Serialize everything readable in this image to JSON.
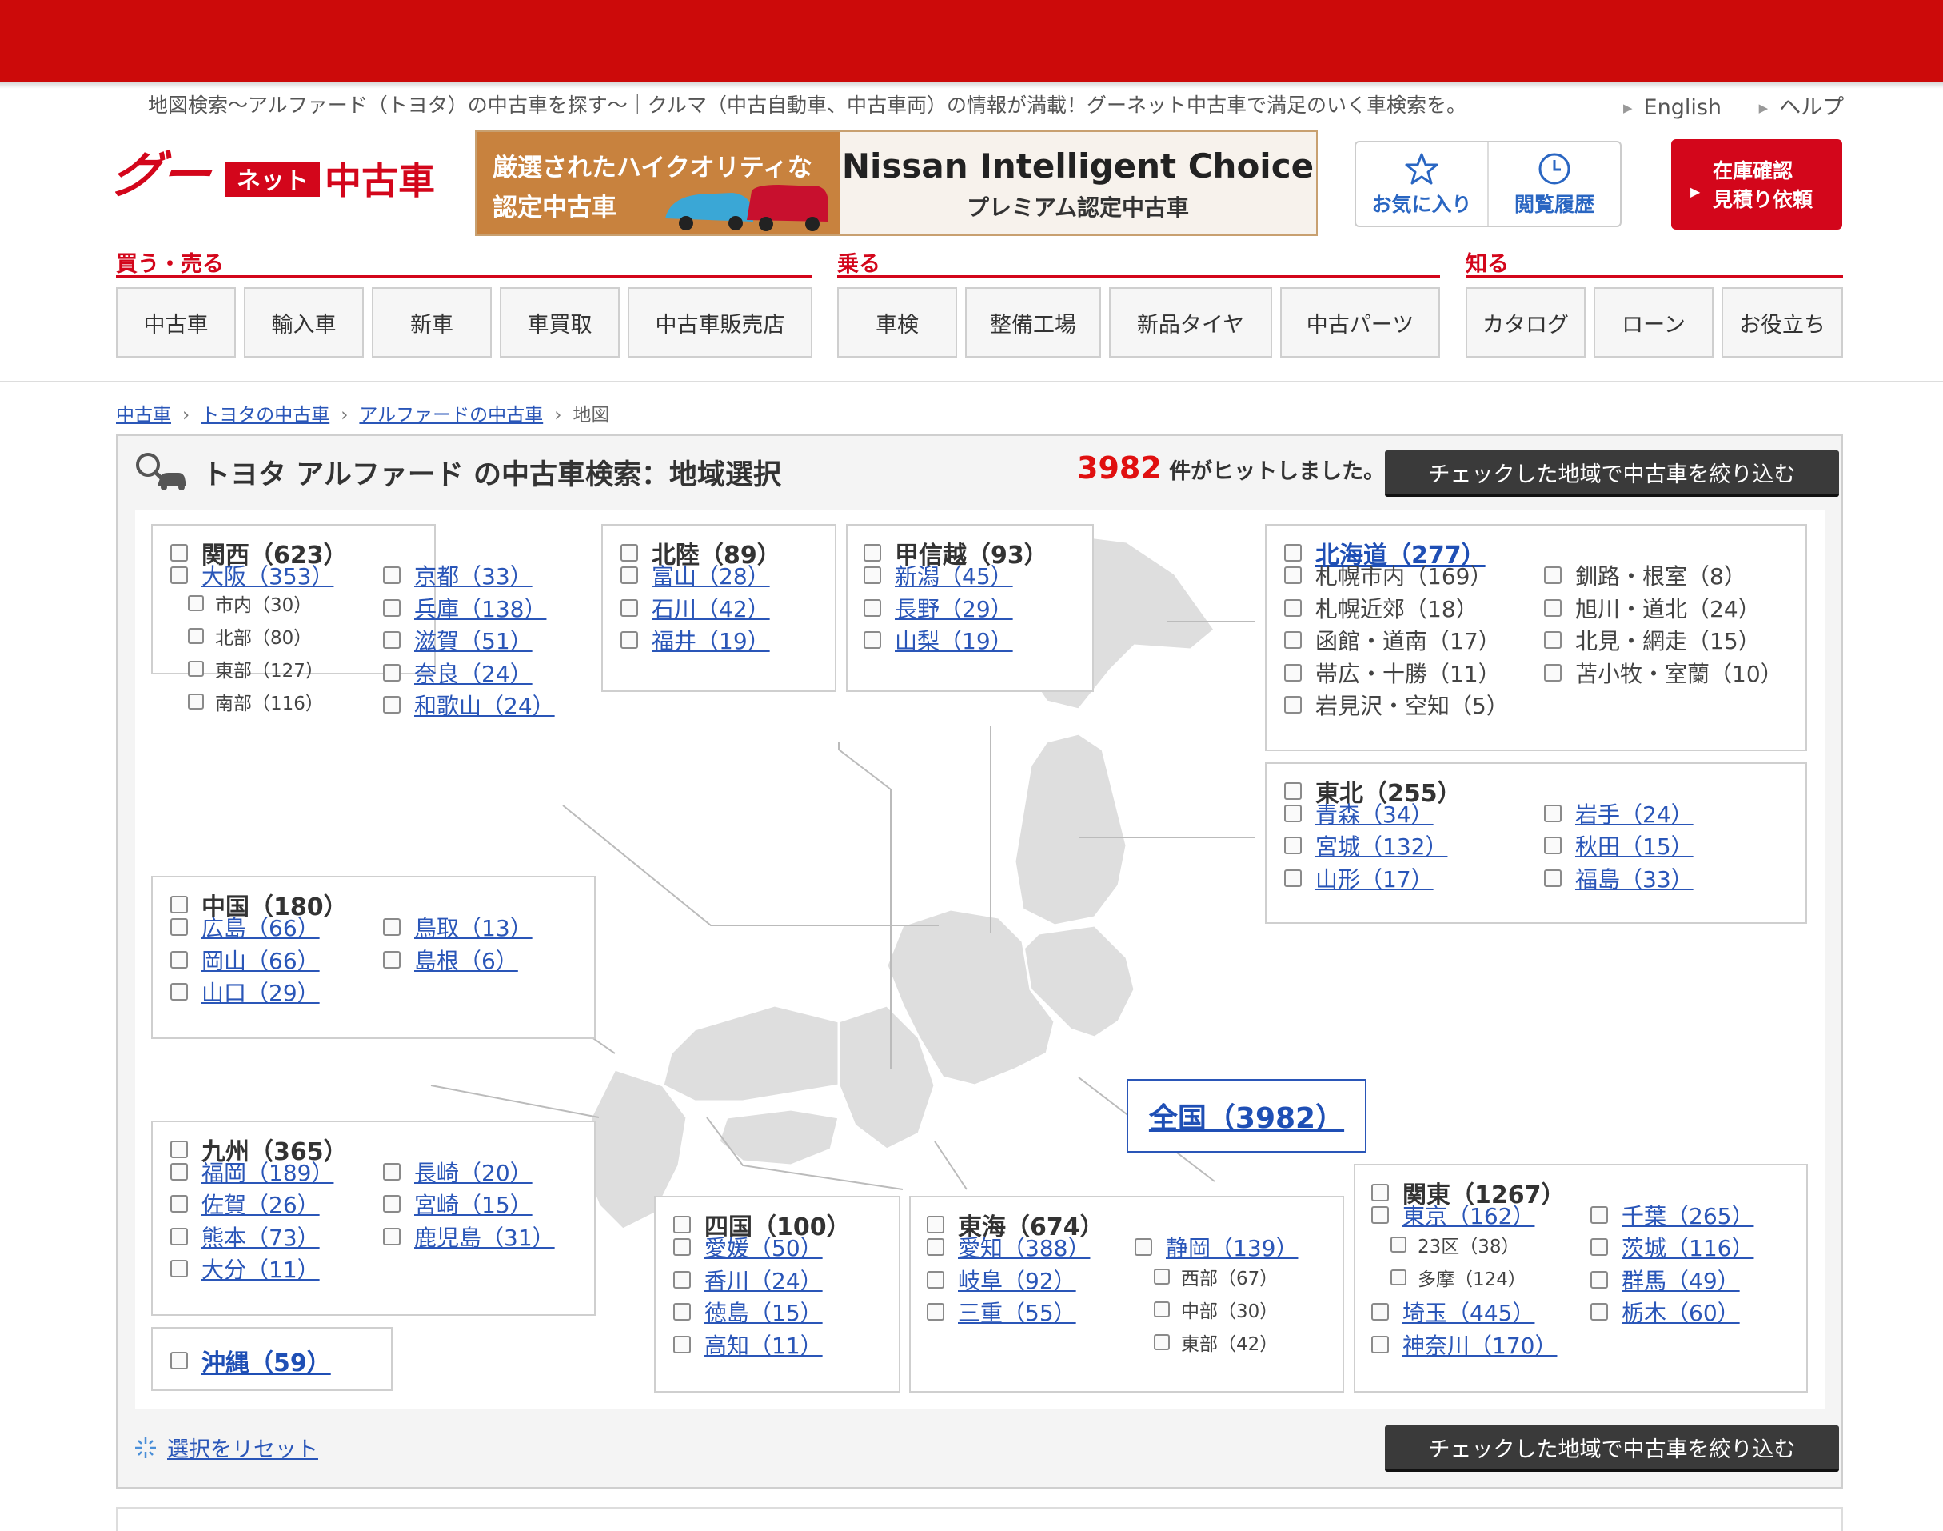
{
  "colors": {
    "brand_red": "#cc0a0a",
    "link_blue": "#2a56b8",
    "hit_red": "#e01010"
  },
  "tagline": "地図検索～アルファード（トヨタ）の中古車を探す～｜クルマ（中古自動車、中古車両）の情報が満載！グーネット中古車で満足のいく車検索を。",
  "header_links": [
    "English",
    "ヘルプ"
  ],
  "logo": {
    "goo": "グー",
    "net": "ネット",
    "used": "中古車"
  },
  "banner": {
    "left_line1": "厳選されたハイクオリティな",
    "left_line2": "認定中古車",
    "title": "Nissan Intelligent Choice",
    "subtitle": "プレミアム認定中古車"
  },
  "util": {
    "favorites": "お気に入り",
    "history": "閲覧履歴",
    "stock_line1": "在庫確認",
    "stock_line2": "見積り依頼"
  },
  "nav": [
    {
      "title": "買う・売る",
      "items": [
        "中古車",
        "輸入車",
        "新車",
        "車買取",
        "中古車販売店"
      ]
    },
    {
      "title": "乗る",
      "items": [
        "車検",
        "整備工場",
        "新品タイヤ",
        "中古パーツ"
      ]
    },
    {
      "title": "知る",
      "items": [
        "カタログ",
        "ローン",
        "お役立ち"
      ]
    }
  ],
  "breadcrumb": [
    "中古車",
    "トヨタの中古車",
    "アルファードの中古車",
    "地図"
  ],
  "search": {
    "title": "トヨタ アルファード の中古車検索：地域選択",
    "hit_count": "3982",
    "hit_suffix": "件がヒットしました。",
    "filter_button": "チェックした地域で中古車を絞り込む",
    "reset": "選択をリセット"
  },
  "all_japan": "全国（3982）",
  "regions": {
    "kansai": {
      "name": "関西（623）",
      "prefs": [
        "大阪（353）",
        "京都（33）",
        "兵庫（138）",
        "滋賀（51）",
        "奈良（24）",
        "和歌山（24）"
      ],
      "subs": [
        "市内（30）",
        "北部（80）",
        "東部（127）",
        "南部（116）"
      ]
    },
    "hokuriku": {
      "name": "北陸（89）",
      "prefs": [
        "富山（28）",
        "石川（42）",
        "福井（19）"
      ]
    },
    "koshinetsu": {
      "name": "甲信越（93）",
      "prefs": [
        "新潟（45）",
        "長野（29）",
        "山梨（19）"
      ]
    },
    "hokkaido": {
      "name": "北海道（277）",
      "subs": [
        "札幌市内（169）",
        "釧路・根室（8）",
        "札幌近郊（18）",
        "旭川・道北（24）",
        "函館・道南（17）",
        "北見・網走（15）",
        "帯広・十勝（11）",
        "苫小牧・室蘭（10）",
        "岩見沢・空知（5）"
      ]
    },
    "tohoku": {
      "name": "東北（255）",
      "prefs": [
        "青森（34）",
        "岩手（24）",
        "宮城（132）",
        "秋田（15）",
        "山形（17）",
        "福島（33）"
      ]
    },
    "chugoku": {
      "name": "中国（180）",
      "prefs": [
        "広島（66）",
        "鳥取（13）",
        "岡山（66）",
        "島根（6）",
        "山口（29）"
      ]
    },
    "kyushu": {
      "name": "九州（365）",
      "prefs": [
        "福岡（189）",
        "長崎（20）",
        "佐賀（26）",
        "宮崎（15）",
        "熊本（73）",
        "鹿児島（31）",
        "大分（11）"
      ]
    },
    "okinawa": {
      "name": "沖縄（59）"
    },
    "shikoku": {
      "name": "四国（100）",
      "prefs": [
        "愛媛（50）",
        "香川（24）",
        "徳島（15）",
        "高知（11）"
      ]
    },
    "tokai": {
      "name": "東海（674）",
      "prefs": [
        "愛知（388）",
        "静岡（139）",
        "岐阜（92）",
        "三重（55）"
      ],
      "subs": [
        "西部（67）",
        "中部（30）",
        "東部（42）"
      ]
    },
    "kanto": {
      "name": "関東（1267）",
      "prefs": [
        "東京（162）",
        "千葉（265）",
        "茨城（116）",
        "群馬（49）",
        "埼玉（445）",
        "栃木（60）",
        "神奈川（170）"
      ],
      "subs": [
        "23区（38）",
        "多摩（124）"
      ]
    }
  }
}
